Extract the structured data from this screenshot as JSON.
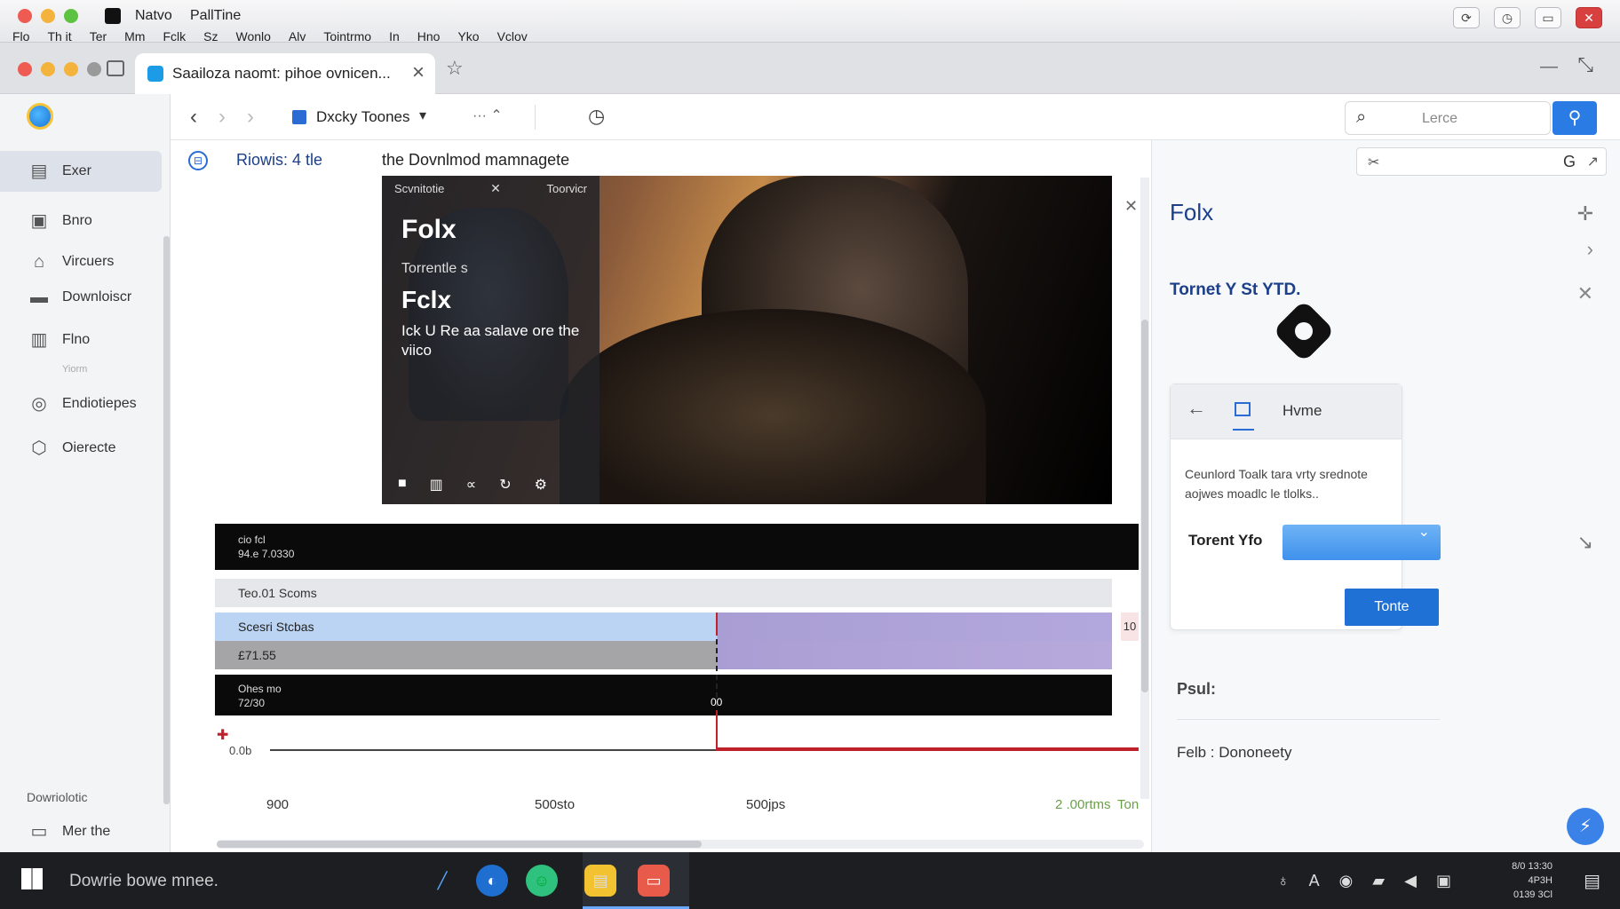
{
  "system": {
    "app_name": "Natvo",
    "app_name2": "PallTine",
    "menu": [
      "Flo",
      "Th it",
      "Ter",
      "Mm",
      "Fclk",
      "Sz",
      "Wonlo",
      "Alv",
      "Tointrmo",
      "In",
      "Hno",
      "Yko",
      "Vclov"
    ]
  },
  "browser": {
    "tab_title": "Saailoza naomt: pihoe ovnicen...",
    "bookmark": "Dxcky Toones"
  },
  "search": {
    "placeholder": "Lerce"
  },
  "sidebar": {
    "items": [
      {
        "label": "Exer",
        "icon": "briefcase-icon"
      },
      {
        "label": "Bnro",
        "icon": "folder-icon"
      },
      {
        "label": "Vircuers",
        "icon": "home-icon"
      },
      {
        "label": "Downloiscr",
        "icon": "download-icon"
      },
      {
        "label": "Flno",
        "icon": "chart-icon"
      },
      {
        "label": "Endiotiepes",
        "icon": "chat-icon"
      },
      {
        "label": "Oierecte",
        "icon": "shield-icon"
      }
    ],
    "sub_label": "Yiorm",
    "section": "Dowriolotic",
    "bottom_item": "Mer the"
  },
  "content": {
    "breadcrumb": "Riowis: 4 tle",
    "title": "the Dovnlmod mamnagete"
  },
  "video": {
    "card_bar_left": "Scvnitotie",
    "card_bar_right": "Toorvicr",
    "heading": "Folx",
    "subline": "Torrentle s",
    "heading2": "Fclx",
    "description": "Ick U Re aa salave ore the viico"
  },
  "timeline": {
    "head_line1": "cio fcl",
    "head_line2": "94.e 7.0330",
    "row1": "Teo.01 Scoms",
    "row2": "Scesri Stcbas",
    "row3": "£71.55",
    "row2_count": "10",
    "foot_line1": "Ohes mo",
    "foot_line2": "72/30",
    "marker_label": "00",
    "axis_value": "0.0b",
    "ticks": [
      "900",
      "500sto",
      "500jps",
      "2 .00rtms"
    ],
    "extra_tick": "Ton"
  },
  "right_panel": {
    "title": "Folx",
    "subtitle": "Tornet Y St YTD.",
    "card": {
      "tab_label": "Hvme",
      "description": "Ceunlord Toalk tara vrty srednote aojwes moadlc le tlolks..",
      "field_label": "Torent Yfo",
      "button": "Tonte"
    },
    "path_label": "Psul:",
    "path_value": "Felb : Dononeety"
  },
  "taskbar": {
    "search_text": "Dowrie bowe mnee.",
    "clock_line1": "8/0 13:30",
    "clock_line2": "4P3H",
    "clock_line3": "0139 3Cl"
  }
}
